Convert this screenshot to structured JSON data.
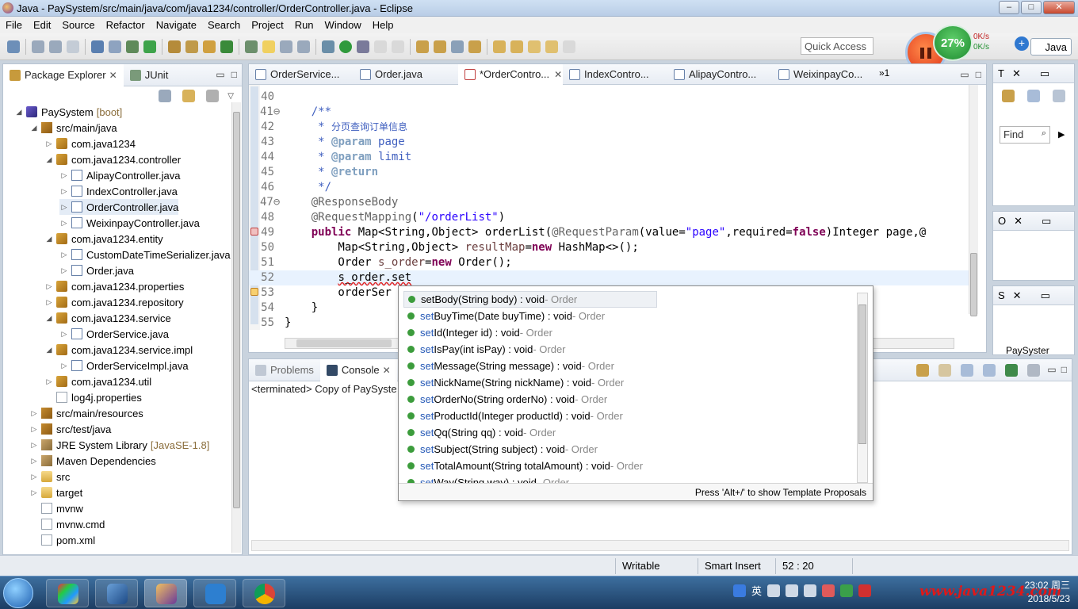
{
  "window": {
    "title": "Java - PaySystem/src/main/java/com/java1234/controller/OrderController.java - Eclipse",
    "buttons": [
      "–",
      "□",
      "✕"
    ]
  },
  "menu": [
    "File",
    "Edit",
    "Source",
    "Refactor",
    "Navigate",
    "Search",
    "Project",
    "Run",
    "Window",
    "Help"
  ],
  "toolbar": {
    "quick_access": "Quick Access",
    "perspective": "Java",
    "recorder_percent": "27%",
    "net_up": "0K/s",
    "net_down": "0K/s"
  },
  "package_explorer": {
    "tabs": [
      {
        "label": "Package Explorer",
        "close": "✕",
        "active": true
      },
      {
        "label": "JUnit",
        "active": false
      }
    ],
    "tree": [
      {
        "label": "PaySystem",
        "decoration": "[boot]",
        "arrow": "◢",
        "icon": "project"
      },
      {
        "label": "src/main/java",
        "arrow": "◢",
        "icon": "source-folder"
      },
      {
        "label": "com.java1234",
        "arrow": "▷",
        "icon": "package"
      },
      {
        "label": "com.java1234.controller",
        "arrow": "◢",
        "icon": "package"
      },
      {
        "label": "AlipayController.java",
        "arrow": "▷",
        "icon": "java-file"
      },
      {
        "label": "IndexController.java",
        "arrow": "▷",
        "icon": "java-file"
      },
      {
        "label": "OrderController.java",
        "arrow": "▷",
        "icon": "java-file",
        "selected": true
      },
      {
        "label": "WeixinpayController.java",
        "arrow": "▷",
        "icon": "java-file"
      },
      {
        "label": "com.java1234.entity",
        "arrow": "◢",
        "icon": "package"
      },
      {
        "label": "CustomDateTimeSerializer.java",
        "arrow": "▷",
        "icon": "java-file"
      },
      {
        "label": "Order.java",
        "arrow": "▷",
        "icon": "java-file"
      },
      {
        "label": "com.java1234.properties",
        "arrow": "▷",
        "icon": "package"
      },
      {
        "label": "com.java1234.repository",
        "arrow": "▷",
        "icon": "package"
      },
      {
        "label": "com.java1234.service",
        "arrow": "◢",
        "icon": "package"
      },
      {
        "label": "OrderService.java",
        "arrow": "▷",
        "icon": "java-file"
      },
      {
        "label": "com.java1234.service.impl",
        "arrow": "◢",
        "icon": "package"
      },
      {
        "label": "OrderServiceImpl.java",
        "arrow": "▷",
        "icon": "java-file"
      },
      {
        "label": "com.java1234.util",
        "arrow": "▷",
        "icon": "package"
      },
      {
        "label": "log4j.properties",
        "arrow": "",
        "icon": "file"
      },
      {
        "label": "src/main/resources",
        "arrow": "▷",
        "icon": "source-folder"
      },
      {
        "label": "src/test/java",
        "arrow": "▷",
        "icon": "source-folder"
      },
      {
        "label": "JRE System Library",
        "decoration": "[JavaSE-1.8]",
        "arrow": "▷",
        "icon": "library"
      },
      {
        "label": "Maven Dependencies",
        "arrow": "▷",
        "icon": "library"
      },
      {
        "label": "src",
        "arrow": "▷",
        "icon": "folder"
      },
      {
        "label": "target",
        "arrow": "▷",
        "icon": "folder"
      },
      {
        "label": "mvnw",
        "arrow": "",
        "icon": "file"
      },
      {
        "label": "mvnw.cmd",
        "arrow": "",
        "icon": "file"
      },
      {
        "label": "pom.xml",
        "arrow": "",
        "icon": "file"
      }
    ]
  },
  "editor": {
    "tabs": [
      {
        "label": "OrderService...",
        "active": false
      },
      {
        "label": "Order.java",
        "active": false
      },
      {
        "label": "*OrderContro...",
        "active": true,
        "close": "✕"
      },
      {
        "label": "IndexContro...",
        "active": false
      },
      {
        "label": "AlipayContro...",
        "active": false
      },
      {
        "label": "WeixinpayCo...",
        "active": false
      }
    ],
    "more_tabs": "»1",
    "lines": [
      {
        "num": "40",
        "segs": [
          {
            "t": ""
          }
        ]
      },
      {
        "num": "41⊖",
        "segs": [
          {
            "t": "    "
          },
          {
            "t": "/**",
            "c": "cm"
          }
        ]
      },
      {
        "num": "42",
        "segs": [
          {
            "t": "     "
          },
          {
            "t": "* ",
            "c": "cm"
          },
          {
            "t": "分页查询订单信息",
            "c": "cm chs"
          }
        ]
      },
      {
        "num": "43",
        "segs": [
          {
            "t": "     "
          },
          {
            "t": "* ",
            "c": "cm"
          },
          {
            "t": "@param",
            "c": "tag"
          },
          {
            "t": " page",
            "c": "cm"
          }
        ]
      },
      {
        "num": "44",
        "segs": [
          {
            "t": "     "
          },
          {
            "t": "* ",
            "c": "cm"
          },
          {
            "t": "@param",
            "c": "tag"
          },
          {
            "t": " limit",
            "c": "cm"
          }
        ]
      },
      {
        "num": "45",
        "segs": [
          {
            "t": "     "
          },
          {
            "t": "* ",
            "c": "cm"
          },
          {
            "t": "@return",
            "c": "tag"
          }
        ]
      },
      {
        "num": "46",
        "segs": [
          {
            "t": "     "
          },
          {
            "t": "*/",
            "c": "cm"
          }
        ]
      },
      {
        "num": "47⊖",
        "segs": [
          {
            "t": "    "
          },
          {
            "t": "@ResponseBody",
            "c": "ann"
          }
        ]
      },
      {
        "num": "48",
        "segs": [
          {
            "t": "    "
          },
          {
            "t": "@RequestMapping",
            "c": "ann"
          },
          {
            "t": "("
          },
          {
            "t": "\"/orderList\"",
            "c": "str"
          },
          {
            "t": ")"
          }
        ]
      },
      {
        "num": "49",
        "segs": [
          {
            "t": "    "
          },
          {
            "t": "public",
            "c": "kw"
          },
          {
            "t": " Map<String,Object> orderList("
          },
          {
            "t": "@RequestParam",
            "c": "ann"
          },
          {
            "t": "(value="
          },
          {
            "t": "\"page\"",
            "c": "str"
          },
          {
            "t": ",required="
          },
          {
            "t": "false",
            "c": "kw"
          },
          {
            "t": ")Integer page,@"
          }
        ]
      },
      {
        "num": "50",
        "segs": [
          {
            "t": "        Map<String,Object> "
          },
          {
            "t": "resultMap",
            "c": "var"
          },
          {
            "t": "="
          },
          {
            "t": "new",
            "c": "kw"
          },
          {
            "t": " HashMap<>();"
          }
        ]
      },
      {
        "num": "51",
        "segs": [
          {
            "t": "        Order "
          },
          {
            "t": "s_order",
            "c": "var"
          },
          {
            "t": "="
          },
          {
            "t": "new",
            "c": "kw"
          },
          {
            "t": " Order();"
          }
        ]
      },
      {
        "num": "52",
        "segs": [
          {
            "t": "        "
          },
          {
            "t": "s_order.set",
            "c": "squig"
          }
        ],
        "current": true
      },
      {
        "num": "53",
        "segs": [
          {
            "t": "        orderSer"
          }
        ]
      },
      {
        "num": "54",
        "segs": [
          {
            "t": "    }"
          }
        ]
      },
      {
        "num": "55",
        "segs": [
          {
            "t": "}"
          }
        ]
      },
      {
        "num": "56",
        "segs": [
          {
            "t": ""
          }
        ]
      }
    ]
  },
  "content_assist": {
    "items": [
      {
        "match": "set",
        "rest": "Body(String body) : void",
        "owner": " - Order"
      },
      {
        "match": "set",
        "rest": "BuyTime(Date buyTime) : void",
        "owner": " - Order"
      },
      {
        "match": "set",
        "rest": "Id(Integer id) : void",
        "owner": " - Order"
      },
      {
        "match": "set",
        "rest": "IsPay(int isPay) : void",
        "owner": " - Order"
      },
      {
        "match": "set",
        "rest": "Message(String message) : void",
        "owner": " - Order"
      },
      {
        "match": "set",
        "rest": "NickName(String nickName) : void",
        "owner": " - Order"
      },
      {
        "match": "set",
        "rest": "OrderNo(String orderNo) : void",
        "owner": " - Order"
      },
      {
        "match": "set",
        "rest": "ProductId(Integer productId) : void",
        "owner": " - Order"
      },
      {
        "match": "set",
        "rest": "Qq(String qq) : void",
        "owner": " - Order"
      },
      {
        "match": "set",
        "rest": "Subject(String subject) : void",
        "owner": " - Order"
      },
      {
        "match": "set",
        "rest": "TotalAmount(String totalAmount) : void",
        "owner": " - Order"
      },
      {
        "match": "set",
        "rest": "Way(String way) : void",
        "owner": " - Order"
      }
    ],
    "footer": "Press 'Alt+/' to show Template Proposals"
  },
  "console": {
    "tabs": [
      {
        "label": "Problems",
        "active": false
      },
      {
        "label": "Console",
        "active": true,
        "close": "✕"
      }
    ],
    "text": "<terminated> Copy of PaySyste"
  },
  "side_views": [
    {
      "label": "T",
      "close": "✕",
      "find": "Find"
    },
    {
      "label": "O",
      "close": "✕"
    },
    {
      "label": "S",
      "close": "✕",
      "item": "PaySyster"
    }
  ],
  "statusbar": {
    "writable": "Writable",
    "insert_mode": "Smart Insert",
    "position": "52 : 20"
  },
  "taskbar": {
    "ime": "英",
    "watermark": "www.java1234.com",
    "time": "23:02 周三",
    "date": "2018/5/23"
  }
}
